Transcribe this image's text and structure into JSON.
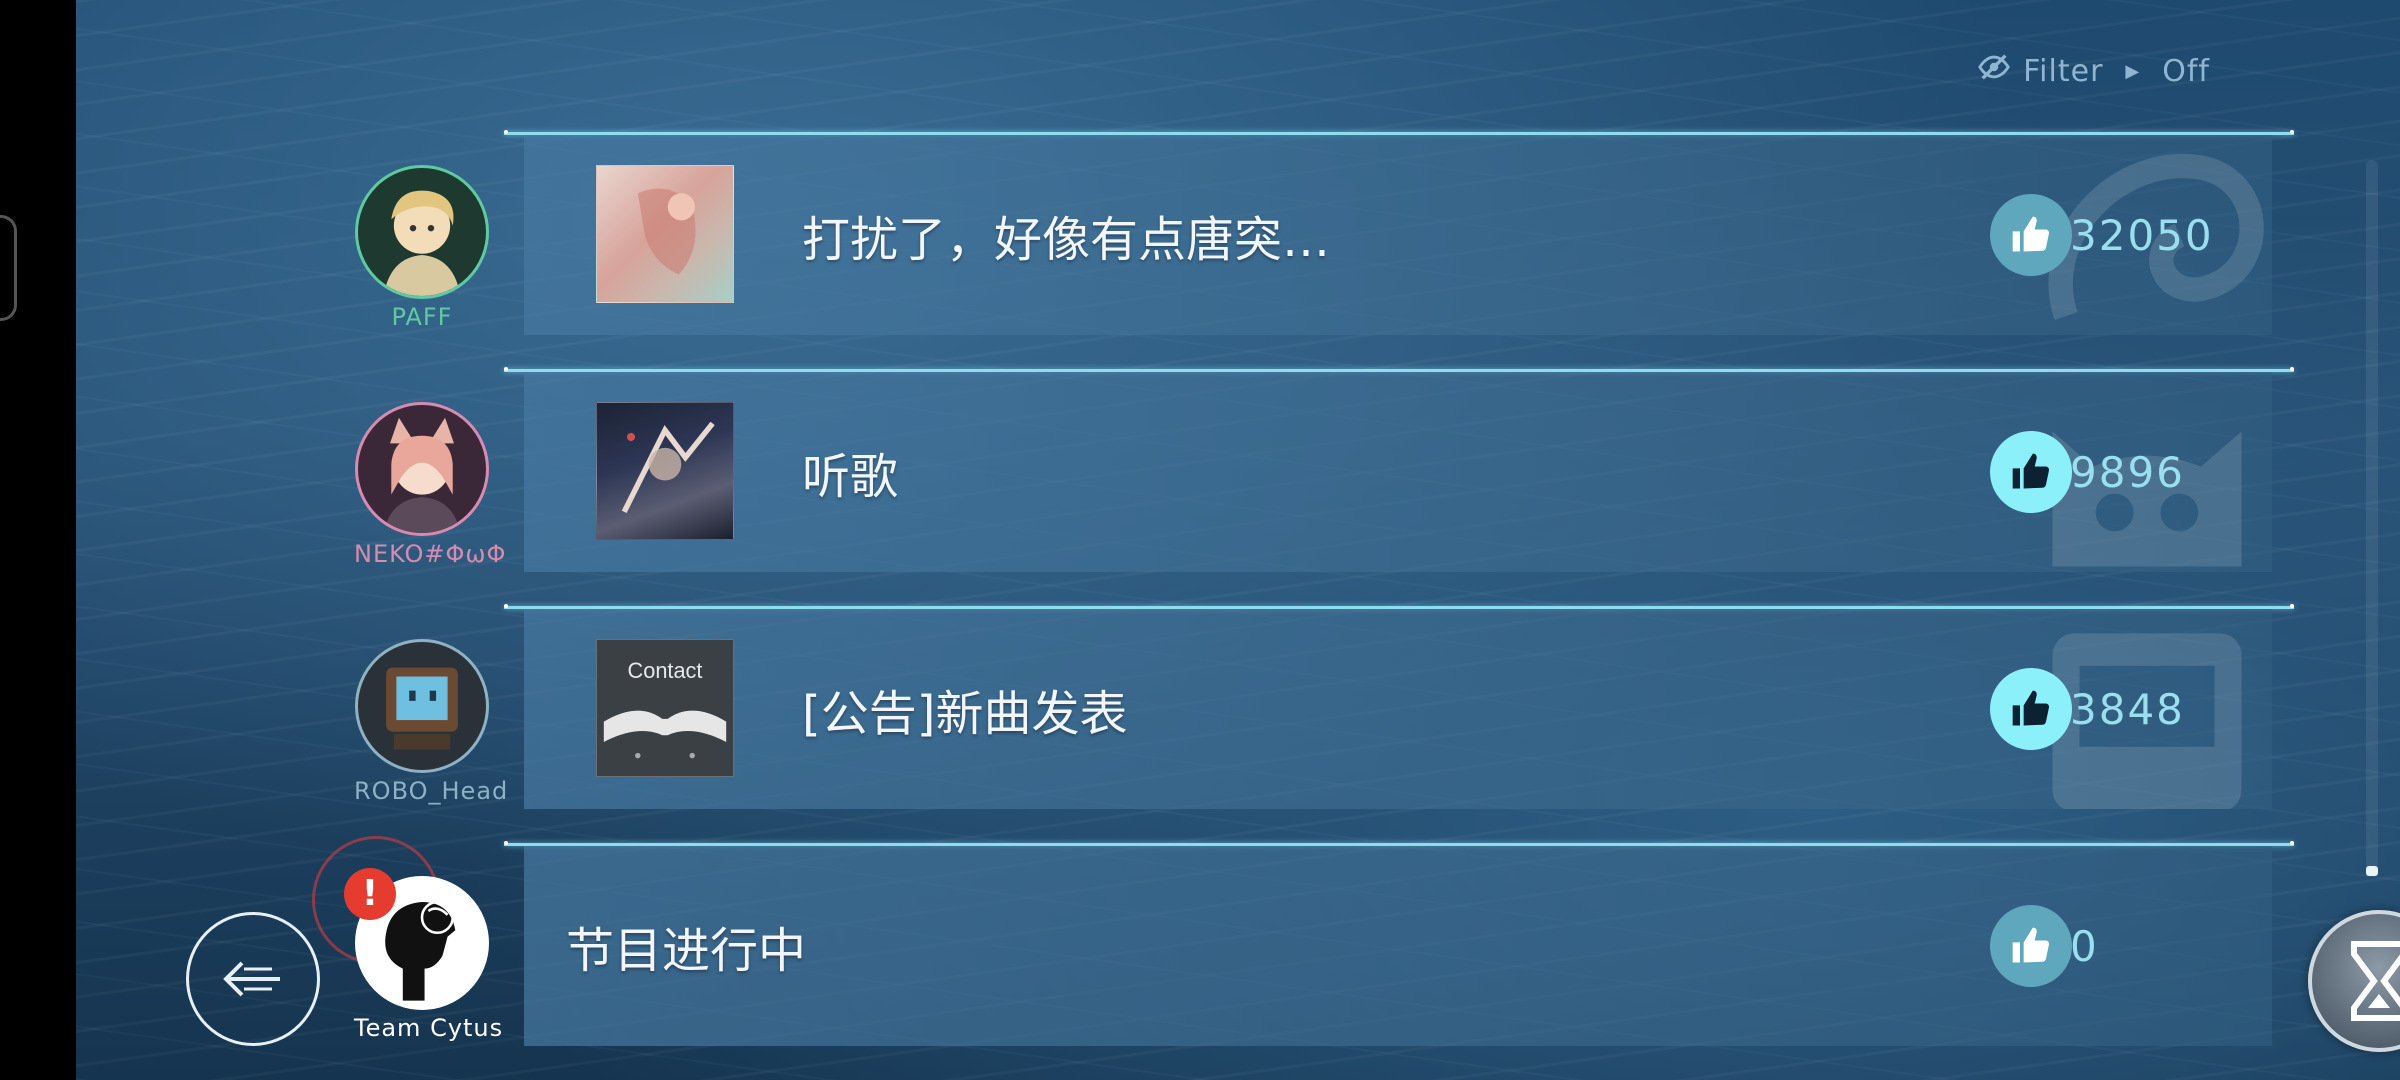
{
  "filter": {
    "label": "Filter",
    "value": "Off",
    "icon": "eye-off-icon"
  },
  "threads": [
    {
      "author": "PAFF",
      "author_color": "#5fc9a0",
      "title": "打扰了，好像有点唐突…",
      "likes": "32050",
      "liked": false,
      "has_thumb": true,
      "watermark": "paff-emblem"
    },
    {
      "author": "NEKO#ΦωΦ",
      "author_color": "#d78bb0",
      "title": "听歌",
      "likes": "9896",
      "liked": true,
      "has_thumb": true,
      "watermark": "neko-emblem"
    },
    {
      "author": "ROBO_Head",
      "author_color": "#8fb1c4",
      "title": "[公告]新曲发表",
      "likes": "3848",
      "liked": true,
      "has_thumb": true,
      "watermark": "robo-emblem"
    },
    {
      "author": "Team Cytus",
      "author_color": "#ffffff",
      "title": "节目进行中",
      "likes": "0",
      "liked": false,
      "has_thumb": false,
      "alert": "!"
    }
  ],
  "thumb_texts": {
    "contact": "Contact"
  },
  "colors": {
    "accent": "#8cf0fb",
    "line": "#8edcf0",
    "alert": "#e63b2f"
  },
  "buttons": {
    "back": "back-arrow-icon",
    "menu": "hourglass-icon"
  }
}
